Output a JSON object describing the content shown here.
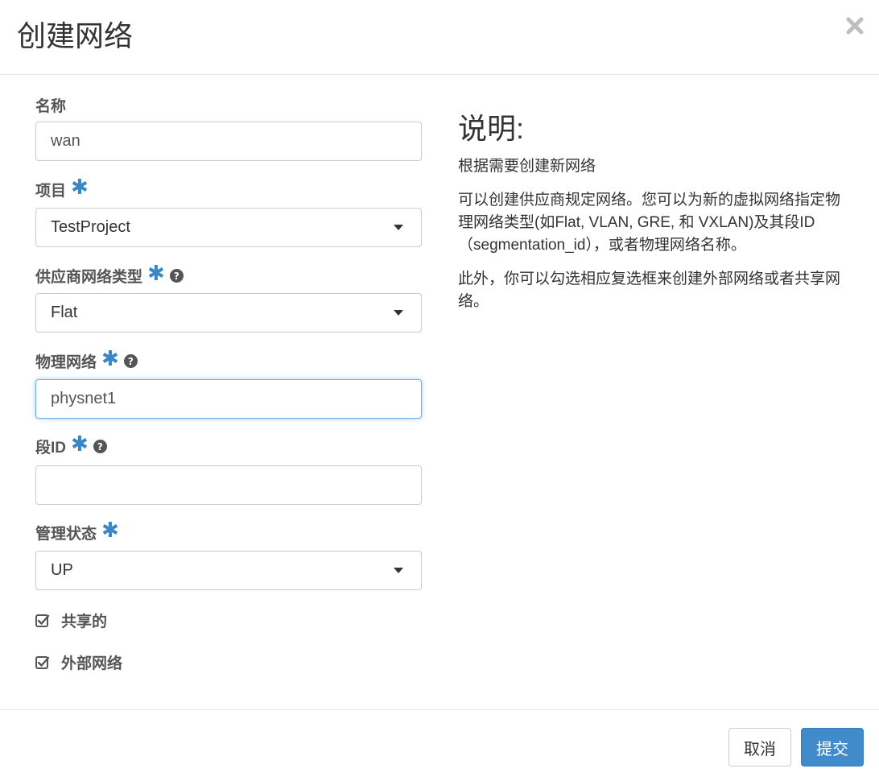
{
  "dialog": {
    "title": "创建网络"
  },
  "form": {
    "name": {
      "label": "名称",
      "value": "wan"
    },
    "project": {
      "label": "项目",
      "value": "TestProject"
    },
    "provider_type": {
      "label": "供应商网络类型",
      "value": "Flat"
    },
    "physical_network": {
      "label": "物理网络",
      "value": "physnet1"
    },
    "segment_id": {
      "label": "段ID",
      "value": ""
    },
    "admin_state": {
      "label": "管理状态",
      "value": "UP"
    },
    "shared": {
      "label": "共享的",
      "checked": true
    },
    "external": {
      "label": "外部网络",
      "checked": true
    }
  },
  "description": {
    "heading": "说明:",
    "paragraphs": [
      "根据需要创建新网络",
      "可以创建供应商规定网络。您可以为新的虚拟网络指定物理网络类型(如Flat, VLAN, GRE, 和 VXLAN)及其段ID（segmentation_id），或者物理网络名称。",
      "此外，你可以勾选相应复选框来创建外部网络或者共享网络。"
    ]
  },
  "footer": {
    "cancel_label": "取消",
    "submit_label": "提交"
  },
  "colors": {
    "primary": "#428bca",
    "required_mark": "#3a87c8",
    "focus_border": "#66afe9"
  },
  "icons": {
    "close": "close-icon",
    "help": "question-circle-icon",
    "checkbox": "check-square-icon",
    "caret": "caret-down-icon"
  }
}
